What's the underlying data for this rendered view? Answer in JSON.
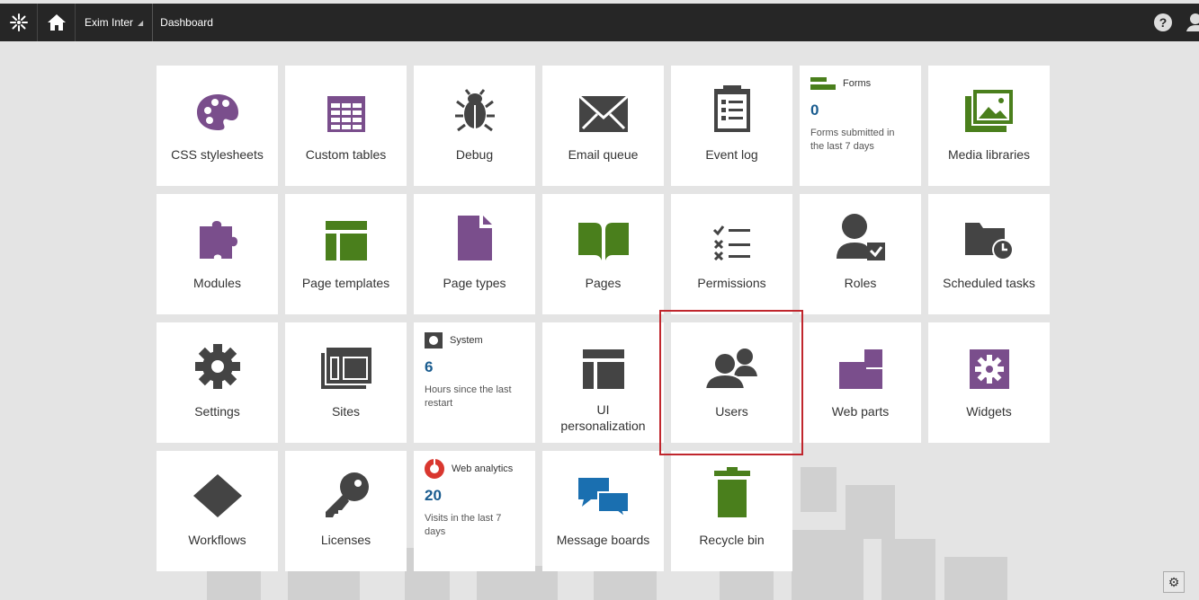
{
  "topbar": {
    "site_name": "Exim Inter",
    "breadcrumb": "Dashboard",
    "help": "?"
  },
  "tiles": [
    {
      "label": "CSS stylesheets",
      "icon": "palette-icon",
      "color": "#7a4e8c"
    },
    {
      "label": "Custom tables",
      "icon": "table-icon",
      "color": "#7a4e8c"
    },
    {
      "label": "Debug",
      "icon": "bug-icon",
      "color": "#444444"
    },
    {
      "label": "Email queue",
      "icon": "envelope-icon",
      "color": "#444444"
    },
    {
      "label": "Event log",
      "icon": "clipboard-list-icon",
      "color": "#444444"
    },
    {
      "label": "Forms",
      "icon": "forms-icon",
      "color": "#4a7f1c",
      "value": "0",
      "description": "Forms submitted in the last 7 days"
    },
    {
      "label": "Media libraries",
      "icon": "picture-icon",
      "color": "#4a7f1c"
    },
    {
      "label": "Modules",
      "icon": "puzzle-icon",
      "color": "#7a4e8c"
    },
    {
      "label": "Page templates",
      "icon": "layout-icon",
      "color": "#4a7f1c"
    },
    {
      "label": "Page types",
      "icon": "document-icon",
      "color": "#7a4e8c"
    },
    {
      "label": "Pages",
      "icon": "book-icon",
      "color": "#4a7f1c"
    },
    {
      "label": "Permissions",
      "icon": "checklist-icon",
      "color": "#444444"
    },
    {
      "label": "Roles",
      "icon": "user-check-icon",
      "color": "#444444"
    },
    {
      "label": "Scheduled tasks",
      "icon": "folder-clock-icon",
      "color": "#444444"
    },
    {
      "label": "Settings",
      "icon": "gear-icon",
      "color": "#444444"
    },
    {
      "label": "Sites",
      "icon": "sites-icon",
      "color": "#444444"
    },
    {
      "label": "System",
      "icon": "system-icon",
      "color": "#444444",
      "value": "6",
      "description": "Hours since the last restart"
    },
    {
      "label": "UI personalization",
      "icon": "layout-icon",
      "color": "#444444"
    },
    {
      "label": "Users",
      "icon": "users-icon",
      "color": "#444444"
    },
    {
      "label": "Web parts",
      "icon": "web-parts-icon",
      "color": "#7a4e8c"
    },
    {
      "label": "Widgets",
      "icon": "widget-gear-icon",
      "color": "#7a4e8c"
    },
    {
      "label": "Workflows",
      "icon": "diamond-icon",
      "color": "#444444"
    },
    {
      "label": "Licenses",
      "icon": "key-icon",
      "color": "#444444"
    },
    {
      "label": "Web analytics",
      "icon": "donut-chart-icon",
      "color": "#d9372f",
      "value": "20",
      "description": "Visits in the last 7 days"
    },
    {
      "label": "Message boards",
      "icon": "chat-icon",
      "color": "#1a6fb0"
    },
    {
      "label": "Recycle bin",
      "icon": "trash-icon",
      "color": "#4a7f1c"
    }
  ]
}
